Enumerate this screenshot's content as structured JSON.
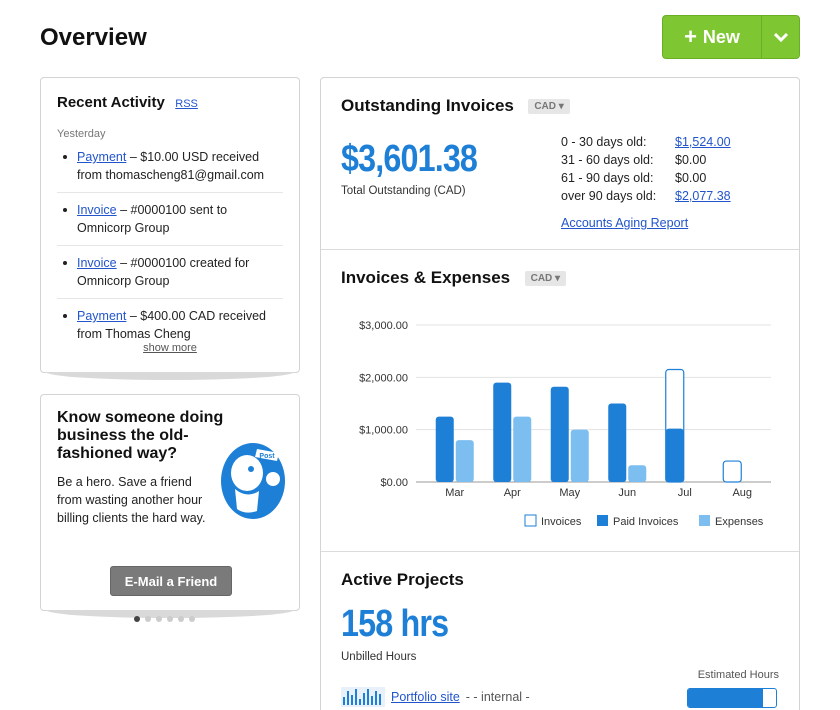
{
  "page": {
    "title": "Overview"
  },
  "new_button": {
    "label": "New",
    "plus": "+"
  },
  "recent_activity": {
    "title": "Recent Activity",
    "rss_label": "RSS",
    "day_label": "Yesterday",
    "items": [
      {
        "link": "Payment",
        "text": " – $10.00 USD received from thomascheng81@gmail.com"
      },
      {
        "link": "Invoice",
        "text": " – #0000100 sent to Omnicorp Group"
      },
      {
        "link": "Invoice",
        "text": " – #0000100 created for Omnicorp Group"
      },
      {
        "link": "Payment",
        "text": " – $400.00 CAD received from Thomas Cheng"
      }
    ],
    "show_more": "show more"
  },
  "promo": {
    "title": "Know someone doing business the old-fashioned way?",
    "body": "Be a hero. Save a friend from wasting another hour billing clients the hard way.",
    "button_label": "E-Mail a Friend",
    "mascot_text": "Post",
    "dots_count": 6,
    "active_dot": 0
  },
  "outstanding": {
    "title": "Outstanding Invoices",
    "currency": "CAD ▾",
    "total": "$3,601.38",
    "total_caption": "Total Outstanding (CAD)",
    "aging": [
      {
        "label": "0 - 30 days old:",
        "value": "$1,524.00",
        "link": true
      },
      {
        "label": "31 - 60 days old:",
        "value": "$0.00",
        "link": false
      },
      {
        "label": "61 - 90 days old:",
        "value": "$0.00",
        "link": false
      },
      {
        "label": "over 90 days old:",
        "value": "$2,077.38",
        "link": true
      }
    ],
    "report_link": "Accounts Aging Report"
  },
  "invoices_expenses": {
    "title": "Invoices & Expenses",
    "currency": "CAD ▾"
  },
  "chart_data": {
    "type": "bar",
    "categories": [
      "Mar",
      "Apr",
      "May",
      "Jun",
      "Jul",
      "Aug"
    ],
    "series": [
      {
        "name": "Invoices",
        "values": [
          0,
          0,
          0,
          0,
          2150,
          400
        ]
      },
      {
        "name": "Paid Invoices",
        "values": [
          1250,
          1900,
          1820,
          1500,
          1020,
          0
        ]
      },
      {
        "name": "Expenses",
        "values": [
          800,
          1250,
          1000,
          320,
          0,
          0
        ]
      }
    ],
    "ylim": [
      0,
      3000
    ],
    "yticks": [
      "$0.00",
      "$1,000.00",
      "$2,000.00",
      "$3,000.00"
    ],
    "colors": {
      "Invoices": "#ffffff",
      "Paid Invoices": "#1e7fd6",
      "Expenses": "#7cbef0",
      "invoice_border": "#1e7fd6"
    },
    "legend_position": "bottom-right"
  },
  "active_projects": {
    "title": "Active Projects",
    "hours": "158 hrs",
    "hours_caption": "Unbilled Hours",
    "estimated_label": "Estimated Hours",
    "projects": [
      {
        "name": "Portfolio site",
        "note": " - - internal -",
        "estimated_fraction": 0.85
      }
    ]
  }
}
